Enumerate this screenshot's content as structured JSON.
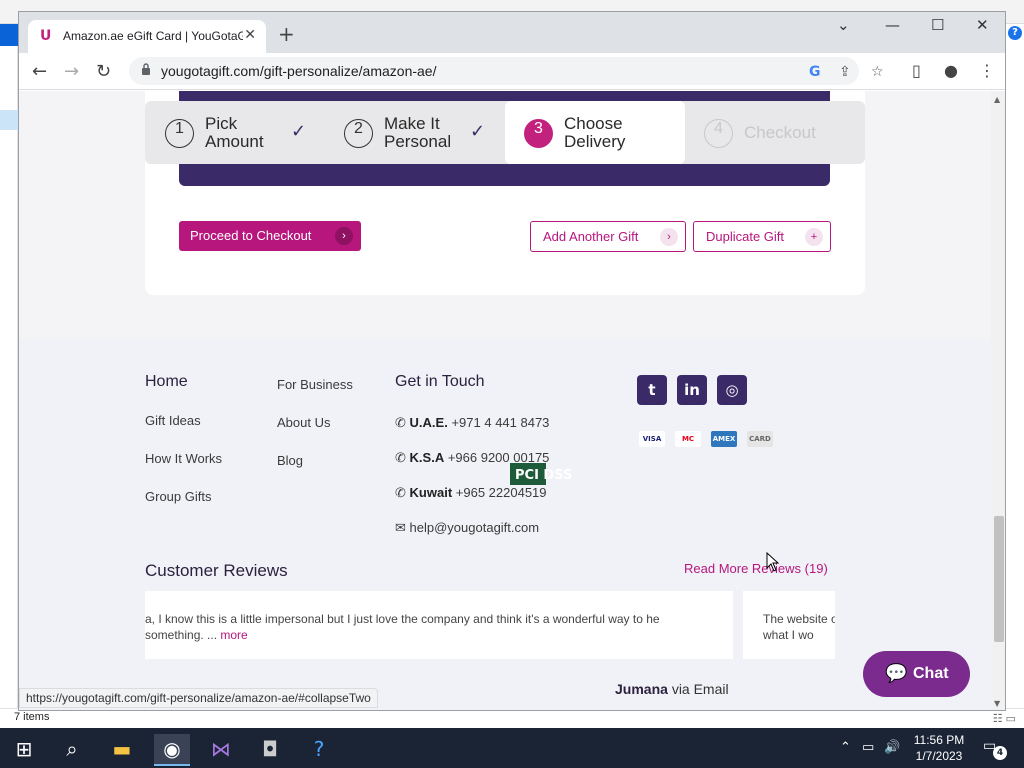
{
  "explorer": {
    "items_count": "7 items"
  },
  "browser": {
    "tab_title": "Amazon.ae eGift Card | YouGotaGift",
    "url": "yougotagift.com/gift-personalize/amazon-ae/",
    "status_url": "https://yougotagift.com/gift-personalize/amazon-ae/#collapseTwo"
  },
  "steps": [
    {
      "num": "1",
      "label_line1": "Pick",
      "label_line2": "Amount",
      "state": "done"
    },
    {
      "num": "2",
      "label_line1": "Make It",
      "label_line2": "Personal",
      "state": "done"
    },
    {
      "num": "3",
      "label_line1": "Choose",
      "label_line2": "Delivery",
      "state": "active"
    },
    {
      "num": "4",
      "label_line1": "Checkout",
      "label_line2": "",
      "state": "disabled"
    }
  ],
  "actions": {
    "proceed": "Proceed to Checkout",
    "add_another": "Add Another Gift",
    "duplicate": "Duplicate Gift"
  },
  "footer": {
    "col1": {
      "heading": "Home",
      "links": [
        "Gift Ideas",
        "How It Works",
        "Group Gifts"
      ]
    },
    "col2": {
      "links": [
        "For Business",
        "About Us",
        "Blog"
      ]
    },
    "contact": {
      "heading": "Get in Touch",
      "uae_label": "U.A.E.",
      "uae_phone": "+971 4 441 8473",
      "ksa_label": "K.S.A",
      "ksa_phone": "+966 9200 00175",
      "kuwait_label": "Kuwait",
      "kuwait_phone": "+965 22204519",
      "email": "help@yougotagift.com"
    },
    "payments": [
      "VISA",
      "MC",
      "AMEX",
      "CARD"
    ],
    "pci": "PCI DSS"
  },
  "reviews": {
    "title": "Customer Reviews",
    "read_more": "Read More Reviews (19)",
    "review1": "a, I know this is a little impersonal but I just love the company and think it's a wonderful way to he something. ...",
    "review1_more": "more",
    "review2": "The website of what I wo",
    "reviewer_name": "Jumana",
    "reviewer_via": "via Email"
  },
  "chat": {
    "label": "Chat"
  },
  "taskbar": {
    "time": "11:56 PM",
    "date": "1/7/2023",
    "notifications": "4"
  },
  "colors": {
    "brand": "#b7167d",
    "purple": "#3a2b68",
    "chat": "#7b2a8e"
  }
}
